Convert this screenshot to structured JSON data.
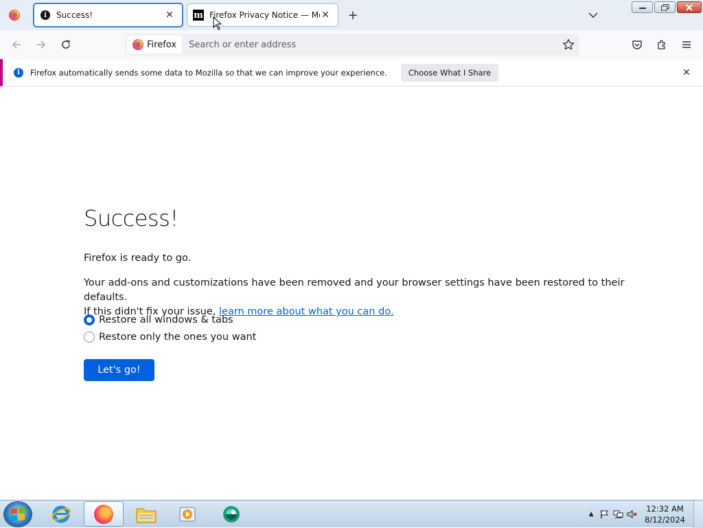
{
  "tabs": [
    {
      "title": "Success!",
      "icon": "info-icon",
      "active": true
    },
    {
      "title": "Firefox Privacy Notice — Mozil",
      "icon": "mozilla-m-icon",
      "active": false
    }
  ],
  "navbar": {
    "identity_label": "Firefox",
    "url_placeholder": "Search or enter address"
  },
  "notification": {
    "message": "Firefox automatically sends some data to Mozilla so that we can improve your experience.",
    "button_label": "Choose What I Share"
  },
  "page": {
    "title": "Success!",
    "ready_text": "Firefox is ready to go.",
    "desc_line1": "Your add-ons and customizations have been removed and your browser settings have been restored to their defaults.",
    "desc_line2_prefix": "If this didn't fix your issue, ",
    "desc_link": "learn more about what you can do.",
    "radio_options": [
      {
        "label": "Restore all windows & tabs",
        "checked": true
      },
      {
        "label": "Restore only the ones you want",
        "checked": false
      }
    ],
    "go_button": "Let's go!"
  },
  "taskbar": {
    "pinned": [
      "internet-explorer-icon",
      "firefox-icon",
      "file-explorer-icon",
      "media-player-icon",
      "app-icon"
    ],
    "clock_time": "12:32 AM",
    "clock_date": "8/12/2024"
  },
  "colors": {
    "accent": "#0060df",
    "notice_stripe": "#c60084",
    "tab_border": "#3b82c4"
  }
}
